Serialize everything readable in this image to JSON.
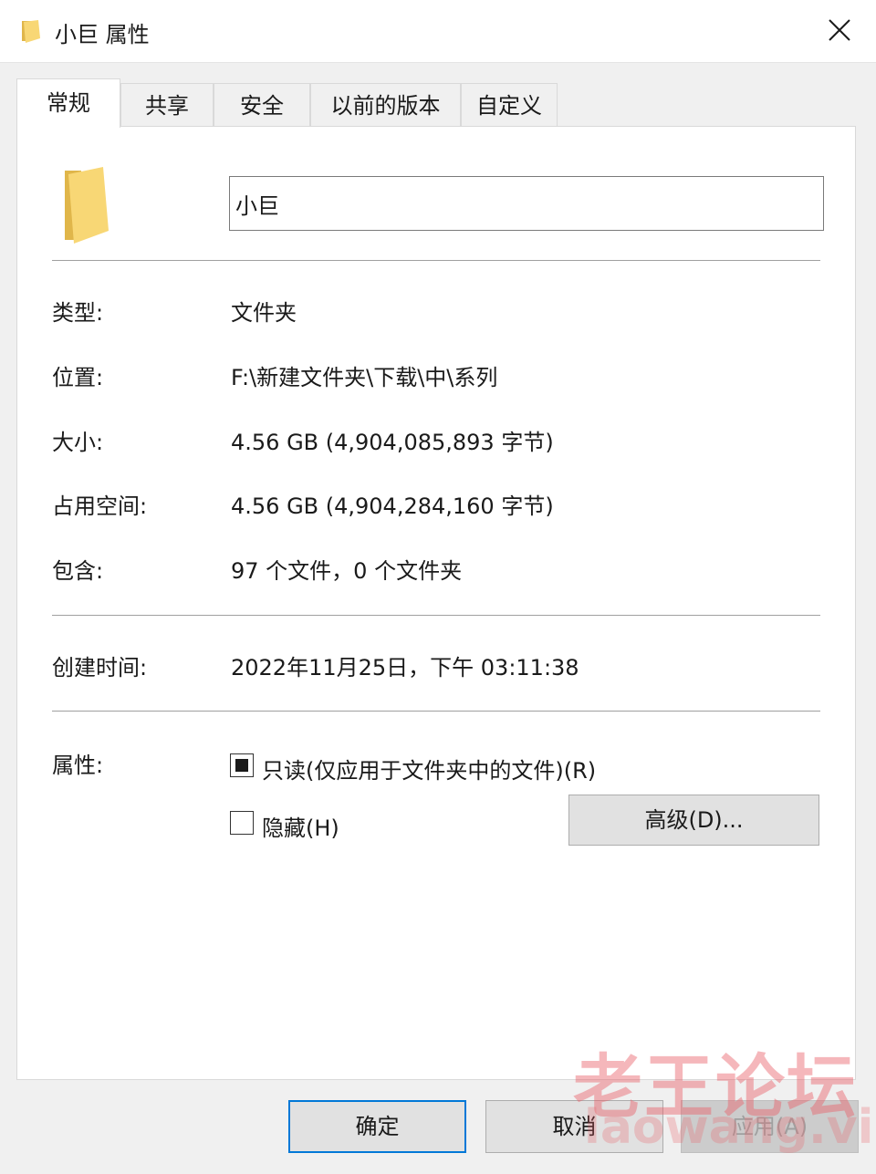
{
  "window": {
    "title": "小巨 属性"
  },
  "tabs": [
    "常规",
    "共享",
    "安全",
    "以前的版本",
    "自定义"
  ],
  "folder_name": "小巨",
  "info": {
    "type_label": "类型:",
    "type_value": "文件夹",
    "location_label": "位置:",
    "location_value": "F:\\新建文件夹\\下载\\中\\系列",
    "size_label": "大小:",
    "size_value": "4.56 GB (4,904,085,893 字节)",
    "disk_label": "占用空间:",
    "disk_value": "4.56 GB (4,904,284,160 字节)",
    "contains_label": "包含:",
    "contains_value": "97 个文件，0 个文件夹"
  },
  "created": {
    "label": "创建时间:",
    "value": "2022年11月25日，下午 03:11:38"
  },
  "attributes": {
    "label": "属性:",
    "readonly_label": "只读(仅应用于文件夹中的文件)(R)",
    "readonly_state": "indeterminate",
    "hidden_label": "隐藏(H)",
    "hidden_state": "unchecked",
    "advanced_label": "高级(D)..."
  },
  "buttons": {
    "ok": "确定",
    "cancel": "取消",
    "apply": "应用(A)"
  },
  "watermark": {
    "cn": "老王论坛",
    "en": "laowang.vip"
  },
  "colors": {
    "folder": "#f8d775",
    "folder_dark": "#e0b64a",
    "accent": "#0078d7"
  }
}
